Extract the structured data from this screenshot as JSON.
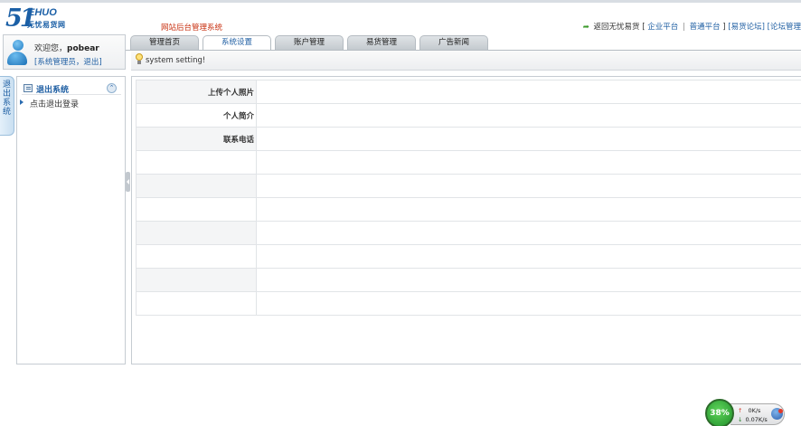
{
  "logo": {
    "big": "51",
    "small": "EHUO",
    "subtitle": "无忧易货网"
  },
  "header": {
    "site_title": "网站后台管理系统",
    "back_link": "返回无忧易货",
    "link_open": "[",
    "links": [
      "企业平台",
      "普通平台"
    ],
    "link_close": "]",
    "forum_link": "[易货论坛]",
    "admin_link": "[论坛管理"
  },
  "user": {
    "greeting": "欢迎您，",
    "username": "pobear",
    "role_line": "[系统管理员，退出]"
  },
  "tabs": [
    {
      "label": "管理首页",
      "active": false
    },
    {
      "label": "系统设置",
      "active": true
    },
    {
      "label": "账户管理",
      "active": false
    },
    {
      "label": "易货管理",
      "active": false
    },
    {
      "label": "广告新闻",
      "active": false
    }
  ],
  "setting_strip": {
    "label": "system setting!"
  },
  "vertical_tab": {
    "label": "退出系统"
  },
  "sidebar": {
    "heading": "退出系统",
    "collapse_icon": "double-chevron-up-icon",
    "items": [
      {
        "label": "点击退出登录"
      }
    ]
  },
  "form": {
    "rows": [
      {
        "label": "上传个人照片",
        "value": ""
      },
      {
        "label": "个人简介",
        "value": ""
      },
      {
        "label": "联系电话",
        "value": ""
      },
      {
        "label": "",
        "value": ""
      },
      {
        "label": "",
        "value": ""
      },
      {
        "label": "",
        "value": ""
      },
      {
        "label": "",
        "value": ""
      },
      {
        "label": "",
        "value": ""
      },
      {
        "label": "",
        "value": ""
      },
      {
        "label": "",
        "value": ""
      }
    ]
  },
  "network_widget": {
    "percent": "38%",
    "upload": "0K/s",
    "download": "0.07K/s"
  },
  "colors": {
    "link_blue": "#1f5fa3",
    "title_red": "#c83010",
    "border_gray": "#c6ccd2"
  }
}
